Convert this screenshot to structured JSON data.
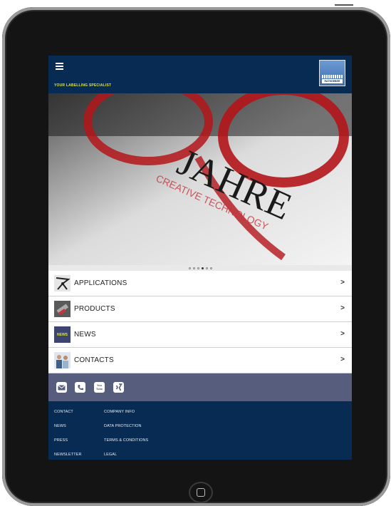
{
  "header": {
    "tagline": "YOUR LABELLING SPECIALIST",
    "logo_text": "RATHGEBER"
  },
  "hero": {
    "headline": "JAHRE",
    "subline": "CREATIVE TECHNOLOGY",
    "slides_total": 6,
    "active_slide": 4
  },
  "menu": [
    {
      "label": "APPLICATIONS",
      "arrow": ">",
      "icon": "applications-thumbnail"
    },
    {
      "label": "PRODUCTS",
      "arrow": ">",
      "icon": "products-thumbnail"
    },
    {
      "label": "NEWS",
      "arrow": ">",
      "icon": "news-thumbnail",
      "badge": "NEWS"
    },
    {
      "label": "CONTACTS",
      "arrow": ">",
      "icon": "contacts-thumbnail"
    }
  ],
  "social": {
    "icons": [
      "mail-icon",
      "phone-icon",
      "youtube-icon",
      "xing-icon"
    ],
    "youtube_text": "You Tube"
  },
  "footer": {
    "col1": [
      "CONTACT",
      "NEWS",
      "PRESS",
      "NEWSLETTER"
    ],
    "col2": [
      "COMPANY INFO",
      "DATA PROTECTION",
      "TERMS & CONDITIONS",
      "LEGAL"
    ]
  },
  "colors": {
    "navy": "#072b52",
    "tagline": "#d8e24a",
    "social_bar": "#575d7c"
  }
}
